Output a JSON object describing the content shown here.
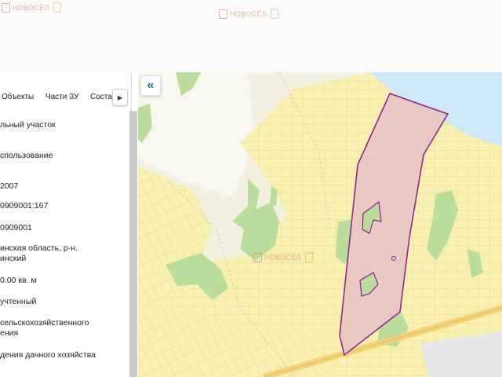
{
  "header": {
    "logo_text": "НОВОСЁЛ"
  },
  "tabs": [
    {
      "label": "Объекты"
    },
    {
      "label": "Части ЗУ"
    },
    {
      "label": "Состав"
    }
  ],
  "tab_next_icon": "chevron-right-icon",
  "fields": [
    {
      "lines": [
        "льный участок"
      ]
    },
    {
      "lines": [
        "спользование"
      ]
    },
    {
      "lines": [
        "2007"
      ]
    },
    {
      "lines": [
        "0909001:167"
      ]
    },
    {
      "lines": [
        "0909001"
      ]
    },
    {
      "lines": [
        "инская область, р-н.",
        "инский"
      ]
    },
    {
      "lines": [
        "0.00 кв. м"
      ]
    },
    {
      "lines": [
        "учтенный"
      ]
    },
    {
      "lines": [
        "сельскохозяйственного",
        "ения"
      ]
    },
    {
      "lines": [
        "дения дачного хозяйства"
      ]
    }
  ],
  "map": {
    "collapse_icon": "double-chevron-left-icon",
    "collapse_label": "«",
    "colors": {
      "background": "#f3f0e2",
      "parcels": "#f7f0b0",
      "parcel_lines": "#e8dc8c",
      "forest": "#b9dd9a",
      "water": "#cfe8f7",
      "selected_fill": "#e8c4c4",
      "selected_stroke": "#8a1f8a",
      "road": "#f2d27a"
    }
  }
}
